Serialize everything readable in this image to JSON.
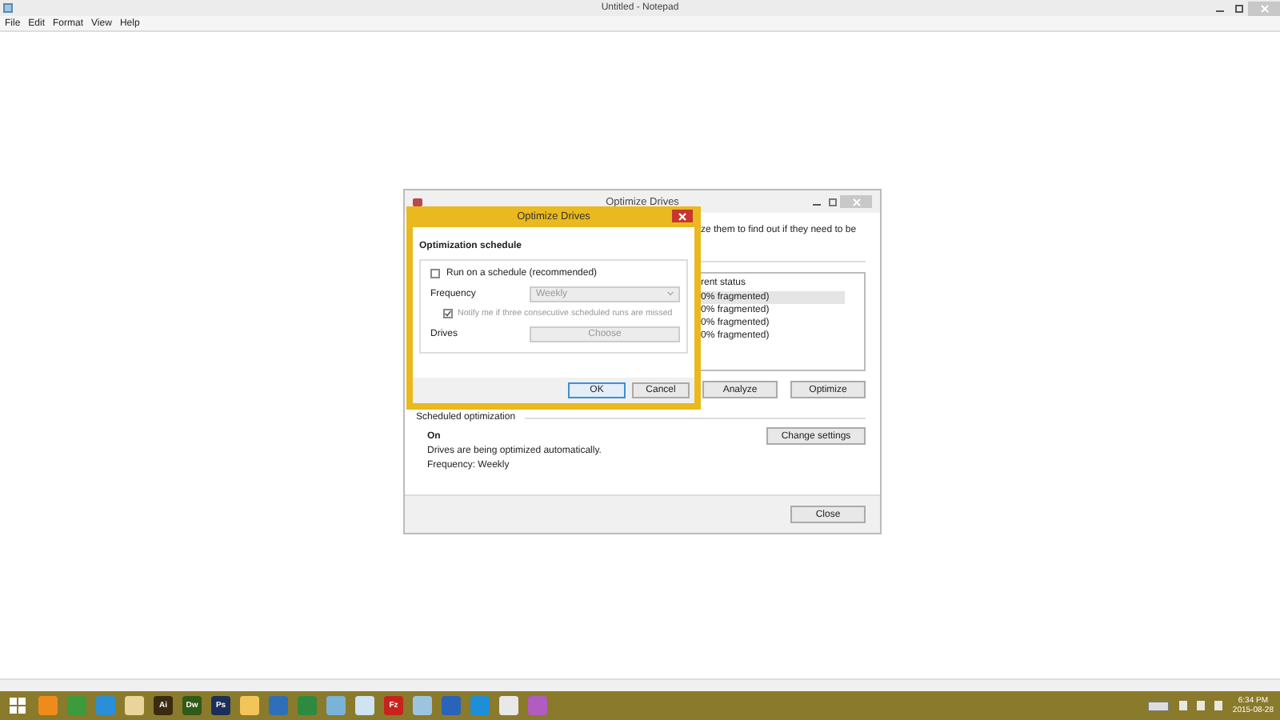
{
  "notepad": {
    "title": "Untitled - Notepad",
    "menu": [
      "File",
      "Edit",
      "Format",
      "View",
      "Help"
    ]
  },
  "optimize_window": {
    "title": "Optimize Drives",
    "description": "ze them to find out if they need to be",
    "list_header": "rent status",
    "drives": [
      {
        "status": "0% fragmented)",
        "selected": true
      },
      {
        "status": "0% fragmented)",
        "selected": false
      },
      {
        "status": "0% fragmented)",
        "selected": false
      },
      {
        "status": "0% fragmented)",
        "selected": false
      }
    ],
    "analyze": "Analyze",
    "optimize": "Optimize",
    "scheduled_heading": "Scheduled optimization",
    "schedule_state": "On",
    "schedule_note": "Drives are being optimized automatically.",
    "schedule_frequency": "Frequency: Weekly",
    "change_settings": "Change settings",
    "close": "Close"
  },
  "dialog": {
    "title": "Optimize Drives",
    "heading": "Optimization schedule",
    "run_on_schedule": {
      "label": "Run on a schedule (recommended)",
      "checked": false
    },
    "frequency_label": "Frequency",
    "frequency_value": "Weekly",
    "disabled": true,
    "notify": {
      "label": "Notify me if three consecutive scheduled runs are missed",
      "checked": true
    },
    "drives_label": "Drives",
    "choose": "Choose",
    "ok": "OK",
    "cancel": "Cancel"
  },
  "taskbar": {
    "items": [
      {
        "kind": "start"
      },
      {
        "kind": "app",
        "color": "#f08a1c"
      },
      {
        "kind": "app",
        "color": "#3c9b3a"
      },
      {
        "kind": "app",
        "color": "#2a8fd8"
      },
      {
        "kind": "app",
        "color": "#e9d59a"
      },
      {
        "kind": "app",
        "color": "#3a2a10",
        "label": "Ai"
      },
      {
        "kind": "app",
        "color": "#2f5a18",
        "label": "Dw"
      },
      {
        "kind": "app",
        "color": "#1c2f5a",
        "label": "Ps"
      },
      {
        "kind": "app",
        "color": "#f2c55a"
      },
      {
        "kind": "app",
        "color": "#2d6fb8"
      },
      {
        "kind": "app",
        "color": "#2e8a3e"
      },
      {
        "kind": "app",
        "color": "#7ab3d8"
      },
      {
        "kind": "app",
        "color": "#cfe3f2"
      },
      {
        "kind": "app",
        "color": "#c8221d",
        "label": "Fz"
      },
      {
        "kind": "app",
        "color": "#9cc4e0"
      },
      {
        "kind": "app",
        "color": "#2a64b8"
      },
      {
        "kind": "app",
        "color": "#1d8ed8"
      },
      {
        "kind": "app",
        "color": "#e8e8e8"
      },
      {
        "kind": "app",
        "color": "#b05cc0"
      }
    ],
    "time": "6:34 PM",
    "date": "2015-08-28"
  }
}
